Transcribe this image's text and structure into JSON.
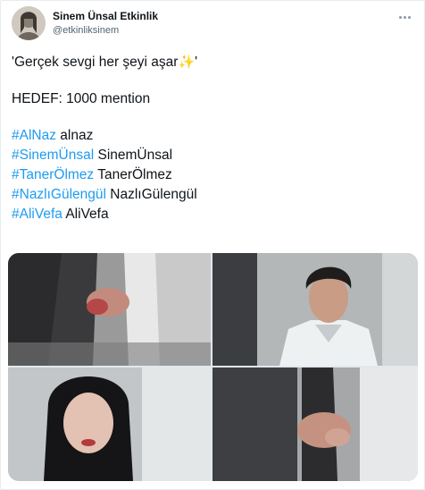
{
  "tweet": {
    "author_name": "Sinem Ünsal Etkinlik",
    "author_handle": "@etkinliksinem",
    "line1_text": "'Gerçek sevgi her şeyi aşar",
    "line1_sparkle": "✨",
    "line1_end": "'",
    "line2": "HEDEF: 1000 mention",
    "hashtags": [
      {
        "tag": "#AlNaz",
        "text": " alnaz"
      },
      {
        "tag": "#SinemÜnsal",
        "text": " SinemÜnsal"
      },
      {
        "tag": "#TanerÖlmez",
        "text": " TanerÖlmez"
      },
      {
        "tag": "#NazlıGülengül",
        "text": " NazlıGülengül"
      },
      {
        "tag": "#AliVefa",
        "text": " AliVefa"
      }
    ]
  },
  "colors": {
    "link": "#1d9bf0",
    "text": "#0f1419",
    "muted": "#536471",
    "border": "#e6ecf0"
  },
  "icons": {
    "more": "more-dots-icon",
    "sparkle": "sparkles-icon"
  }
}
